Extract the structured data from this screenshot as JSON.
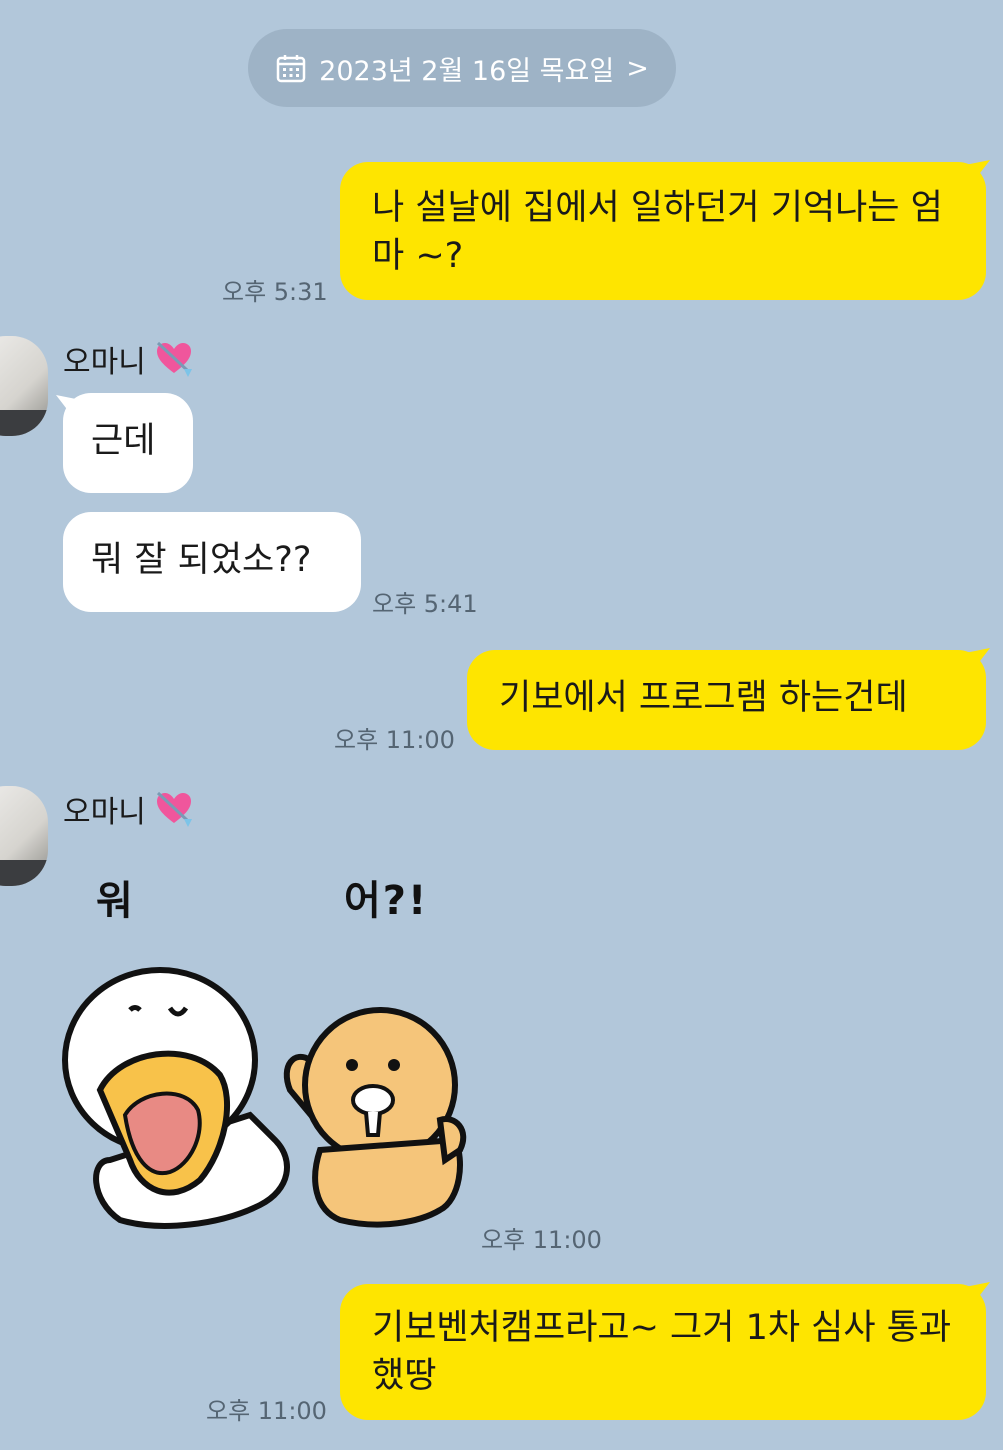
{
  "date_header": {
    "text": "2023년 2월 16일 목요일",
    "chevron": ">",
    "icon": "calendar-icon"
  },
  "messages": [
    {
      "from": "me",
      "text": "나 설날에 집에서 일하던거 기억나는 엄마 ~?",
      "time": "오후 5:31"
    },
    {
      "from": "other",
      "sender": "오마니",
      "text": "근데"
    },
    {
      "from": "other",
      "text": "뭐 잘 되었소??",
      "time": "오후 5:41"
    },
    {
      "from": "me",
      "text": "기보에서 프로그램 하는건데",
      "time": "오후 11:00"
    },
    {
      "from": "other",
      "sender": "오마니",
      "sticker": {
        "text_left": "워",
        "text_right": "어?!"
      },
      "time": "오후 11:00"
    },
    {
      "from": "me",
      "text": "기보벤처캠프라고~ 그거 1차 심사 통과했땅",
      "time": "오후 11:00"
    }
  ],
  "colors": {
    "background": "#b2c7da",
    "my_bubble": "#fee500",
    "their_bubble": "#ffffff",
    "date_pill": "#9eb3c6"
  },
  "sender_badge_icon": "heart-with-arrow-icon"
}
